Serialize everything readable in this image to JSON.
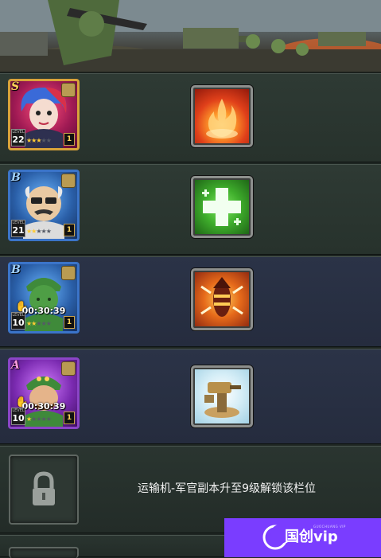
{
  "banner": {
    "description_icon": "battle-scene-banner"
  },
  "slots": [
    {
      "rank": "S",
      "level_caption": "LEVEL",
      "level": "22",
      "stars_on": 3,
      "stars_total": 5,
      "badge": "1",
      "timer": "",
      "skill_icon": "fire-blast-icon"
    },
    {
      "rank": "B",
      "level_caption": "LEVEL",
      "level": "21",
      "stars_on": 2,
      "stars_total": 5,
      "badge": "1",
      "timer": "",
      "skill_icon": "heal-cross-icon"
    },
    {
      "rank": "B",
      "level_caption": "LEVEL",
      "level": "10",
      "stars_on": 2,
      "stars_total": 5,
      "badge": "1",
      "timer": "00:30:39",
      "skill_icon": "missile-strike-icon"
    },
    {
      "rank": "A",
      "level_caption": "LEVEL",
      "level": "10",
      "stars_on": 1,
      "stars_total": 5,
      "badge": "1",
      "timer": "00:30:39",
      "skill_icon": "turret-tower-icon"
    }
  ],
  "locked_slot": {
    "icon": "padlock-icon",
    "message": "运输机-军官副本升至9级解锁该栏位"
  },
  "watermark": {
    "text": "国创vip",
    "sub": "GUOCHUANG VIP"
  },
  "colors": {
    "rank_s": "#d9a23a",
    "rank_b": "#3b74c9",
    "rank_a": "#8b45c7",
    "row_green": "#2e3a34",
    "row_navy": "#2b3347",
    "watermark_bg": "#7a3dff"
  }
}
